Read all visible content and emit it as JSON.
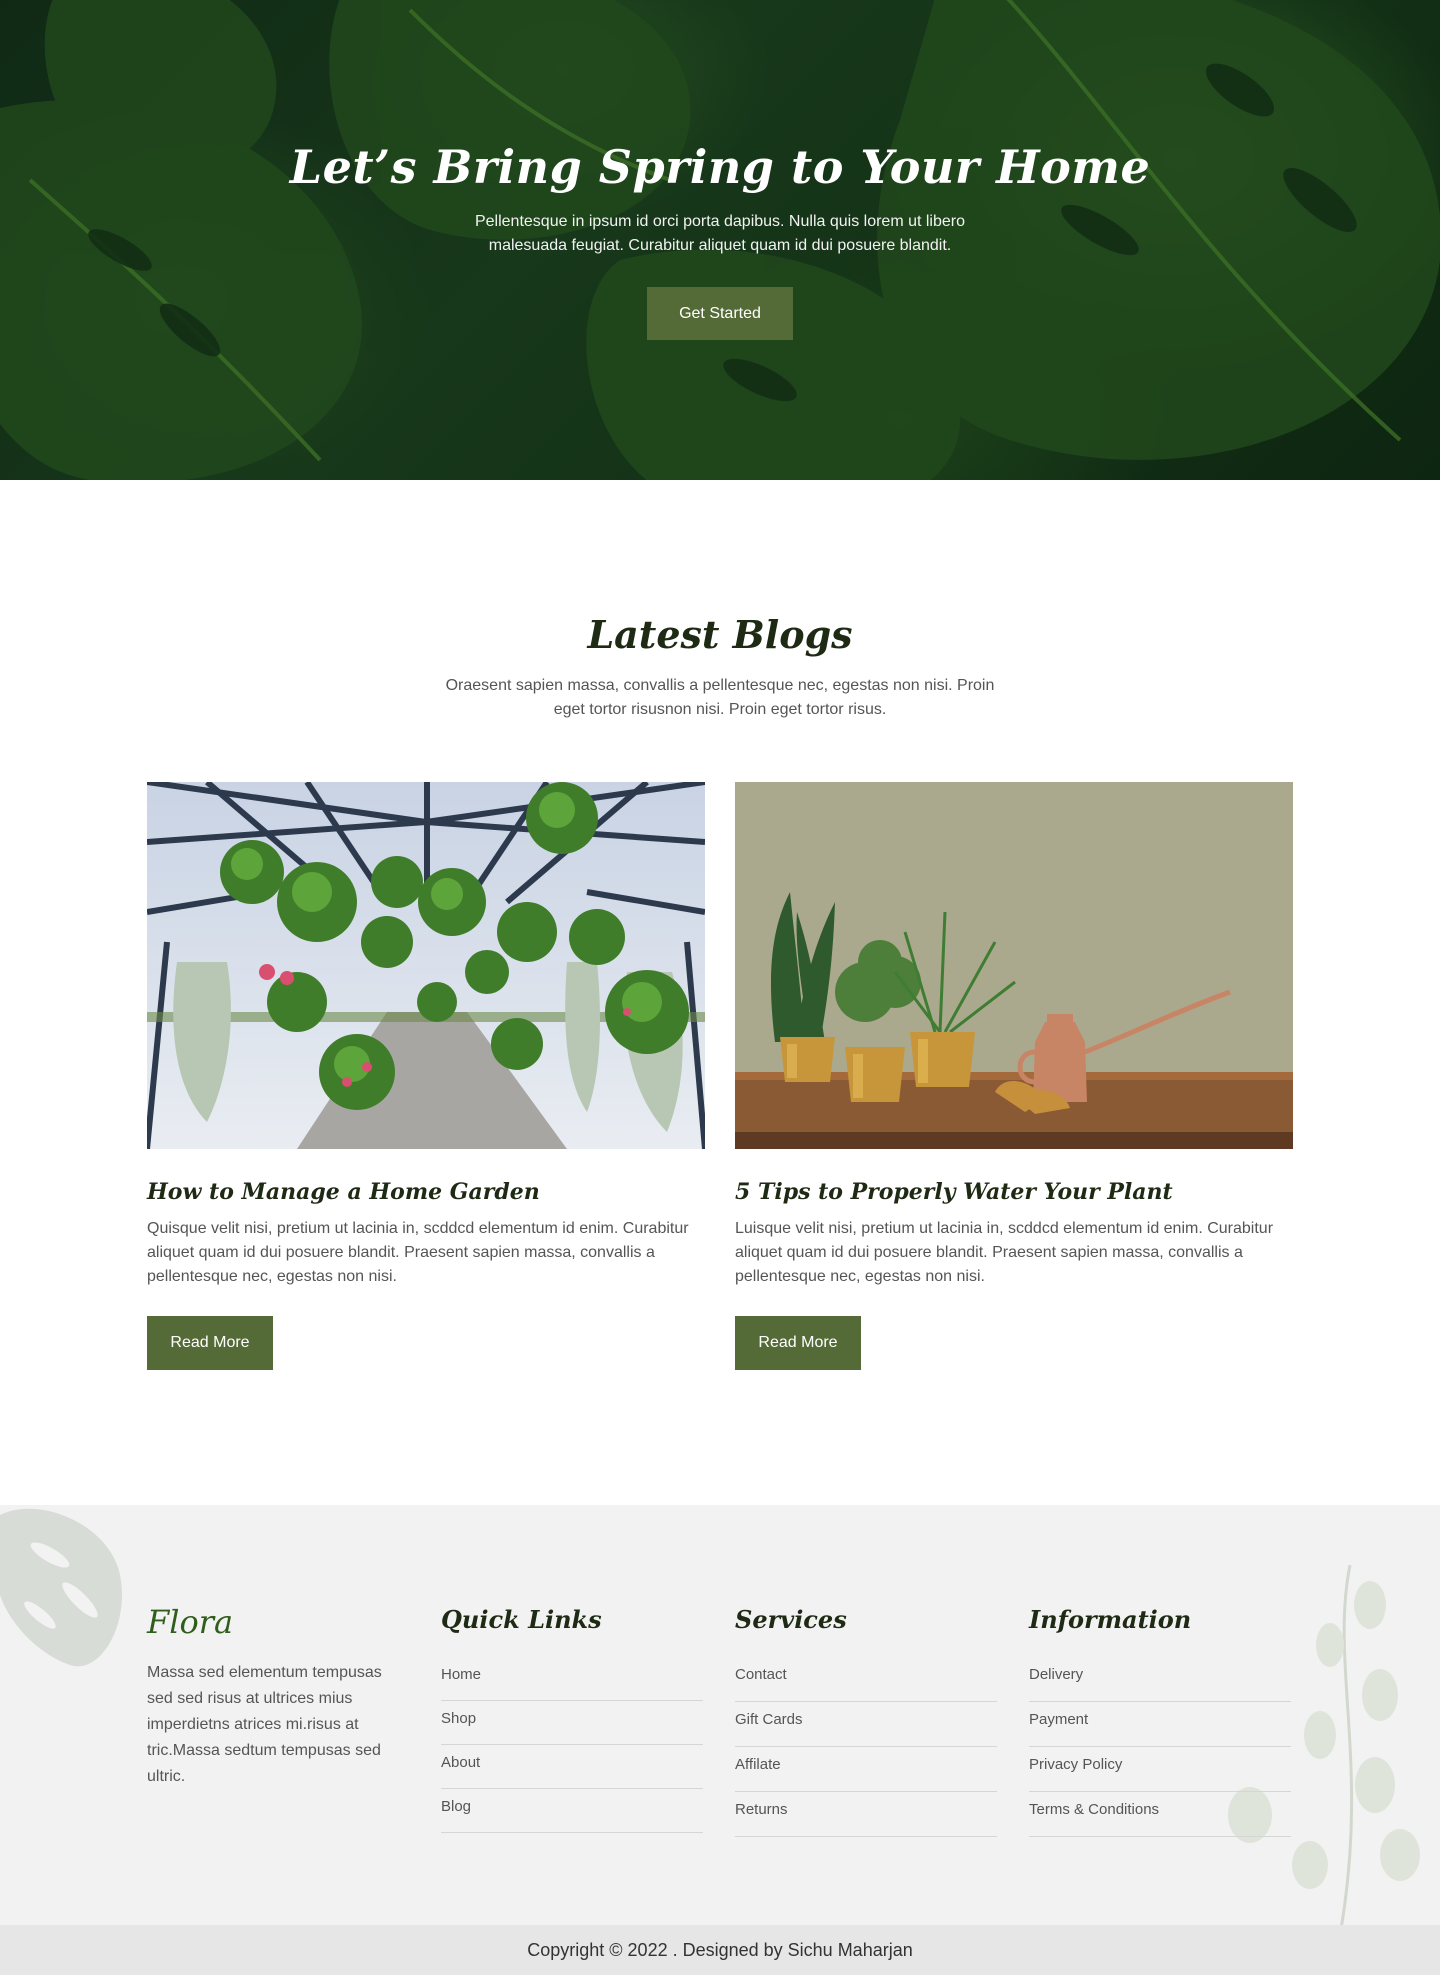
{
  "hero": {
    "title": "Let’s Bring Spring to Your Home",
    "subtitle": "Pellentesque in ipsum id orci porta dapibus. Nulla quis lorem ut libero malesuada feugiat. Curabitur aliquet quam id dui posuere blandit.",
    "cta_label": "Get Started",
    "accent_color": "#556b37"
  },
  "blogs": {
    "title": "Latest Blogs",
    "subtitle": "Oraesent sapien massa, convallis a pellentesque nec, egestas non nisi. Proin eget tortor risusnon nisi. Proin eget tortor risus.",
    "posts": [
      {
        "title": "How to Manage a Home Garden",
        "text": "Quisque velit nisi, pretium ut lacinia in, scddcd elementum id enim. Curabitur aliquet quam id dui posuere blandit. Praesent sapien massa, convallis a pellentesque nec, egestas non nisi.",
        "button": "Read More",
        "image": "greenhouse-hanging-plants"
      },
      {
        "title": "5 Tips  to Properly Water Your Plant",
        "text": "Luisque velit nisi, pretium ut lacinia in, scddcd elementum id enim. Curabitur aliquet quam id dui posuere blandit. Praesent sapien massa, convallis a pellentesque nec, egestas non nisi.",
        "button": "Read More",
        "image": "potted-plants-watering-can"
      }
    ]
  },
  "footer": {
    "brand": "Flora",
    "about": "Massa sed elementum tempusas sed sed risus at ultrices mius imperdietns atrices mi.risus at tric.Massa sedtum tempusas sed ultric.",
    "columns": [
      {
        "title": "Quick Links",
        "items": [
          "Home",
          "Shop",
          "About",
          "Blog"
        ]
      },
      {
        "title": "Services",
        "items": [
          "Contact",
          "Gift Cards",
          "Affilate",
          "Returns"
        ]
      },
      {
        "title": "Information",
        "items": [
          "Delivery",
          "Payment",
          "Privacy Policy",
          "Terms & Conditions"
        ]
      }
    ],
    "copyright": "Copyright © 2022 . Designed by Sichu Maharjan"
  }
}
